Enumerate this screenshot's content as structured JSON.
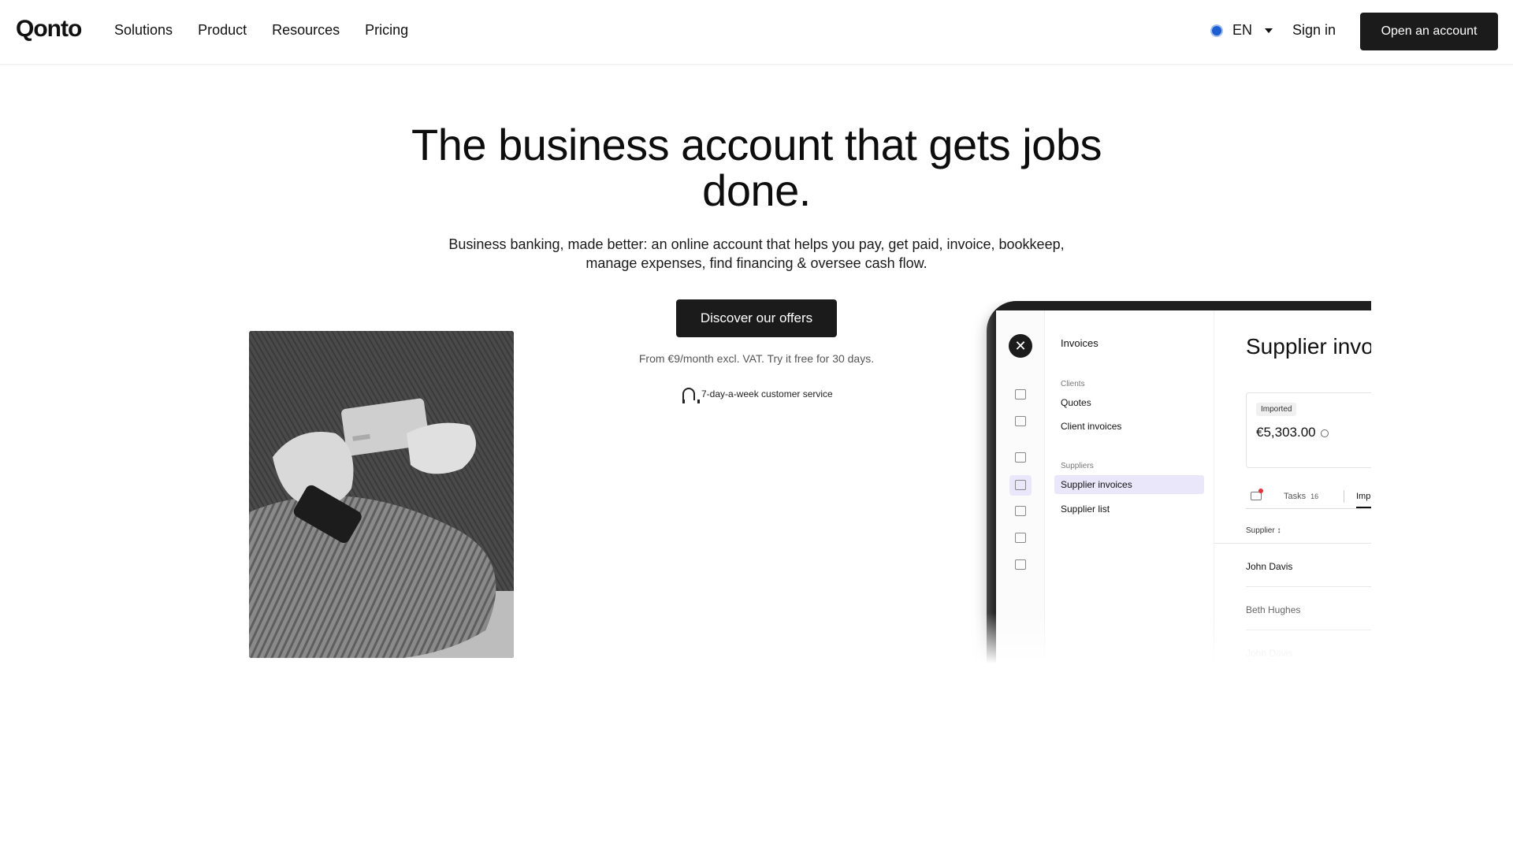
{
  "header": {
    "logo": "Qonto",
    "nav": [
      "Solutions",
      "Product",
      "Resources",
      "Pricing"
    ],
    "language": "EN",
    "sign_in": "Sign in",
    "open_account": "Open an account"
  },
  "hero": {
    "title": "The business account that gets jobs done.",
    "subtitle": "Business banking, made better: an online account that helps you pay, get paid, invoice, bookkeep, manage expenses, find financing & oversee cash flow.",
    "cta": "Discover our offers",
    "pricing_note": "From €9/month excl. VAT. Try it free for 30 days.",
    "service_note": "7-day-a-week customer service"
  },
  "app_mockup": {
    "menu_title": "Invoices",
    "clients_group": "Clients",
    "clients_items": [
      "Quotes",
      "Client invoices"
    ],
    "suppliers_group": "Suppliers",
    "suppliers_items": [
      "Supplier invoices",
      "Supplier list"
    ],
    "page_title": "Supplier invo",
    "card": {
      "badge": "Imported",
      "amount": "€5,303.00"
    },
    "tabs": {
      "tasks_label": "Tasks",
      "tasks_count": "16",
      "imp_label": "Imp"
    },
    "column_header": "Supplier ↕",
    "rows": [
      "John Davis",
      "Beth Hughes",
      "John Davis"
    ]
  },
  "colors": {
    "primary_button": "#1b1b1b",
    "accent_highlight": "#e9e7f9",
    "globe": "#1d5fd0",
    "notification": "#e0333a"
  }
}
